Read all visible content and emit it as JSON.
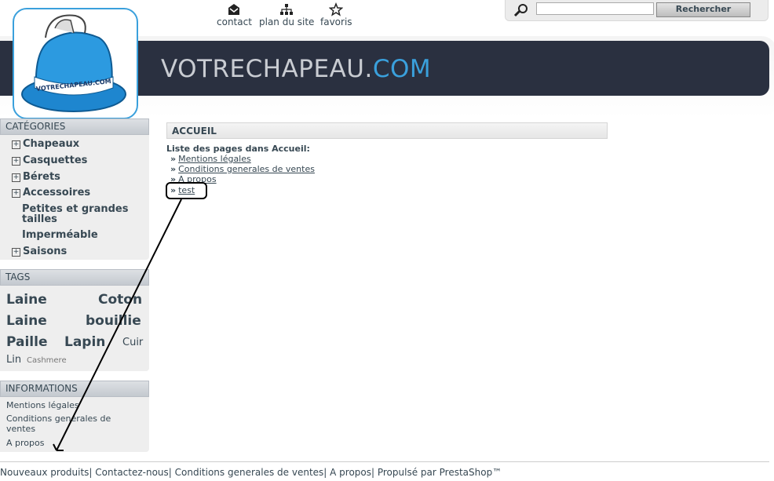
{
  "header": {
    "site_name": "VOTRECHAPEAU.",
    "site_tld": "COM",
    "logo_text": "VOTRECHAPEAU.COM",
    "links": [
      {
        "label": "contact",
        "icon": "mail-icon"
      },
      {
        "label": "plan du site",
        "icon": "sitemap-icon"
      },
      {
        "label": "favoris",
        "icon": "star-icon"
      }
    ],
    "search": {
      "value": "",
      "button": "Rechercher",
      "icon": "magnifier-icon"
    }
  },
  "categories": {
    "title": "Catégories",
    "items": [
      {
        "label": "Chapeaux",
        "expandable": true
      },
      {
        "label": "Casquettes",
        "expandable": true
      },
      {
        "label": "Bérets",
        "expandable": true
      },
      {
        "label": "Accessoires",
        "expandable": true
      },
      {
        "label": "Petites et grandes tailles",
        "expandable": false
      },
      {
        "label": "Imperméable",
        "expandable": false
      },
      {
        "label": "Saisons",
        "expandable": true
      }
    ]
  },
  "tags": {
    "title": "Tags",
    "items": [
      "Laine",
      "Coton",
      "Laine",
      "bouillie",
      "Paille",
      "Lapin",
      "Cuir",
      "Lin",
      "Cashmere"
    ]
  },
  "informations": {
    "title": "Informations",
    "items": [
      "Mentions légales",
      "Conditions generales de ventes",
      "A propos"
    ]
  },
  "main": {
    "title": "ACCUEIL",
    "subtitle": "Liste des pages dans Accueil:",
    "pages": [
      "Mentions légales",
      "Conditions generales de ventes",
      "A propos",
      "test"
    ],
    "arrow_glyph": "»"
  },
  "footer": {
    "text": "Nouveaux produits| Contactez-nous| Conditions generales de ventes| A propos| Propulsé par PrestaShop™"
  }
}
